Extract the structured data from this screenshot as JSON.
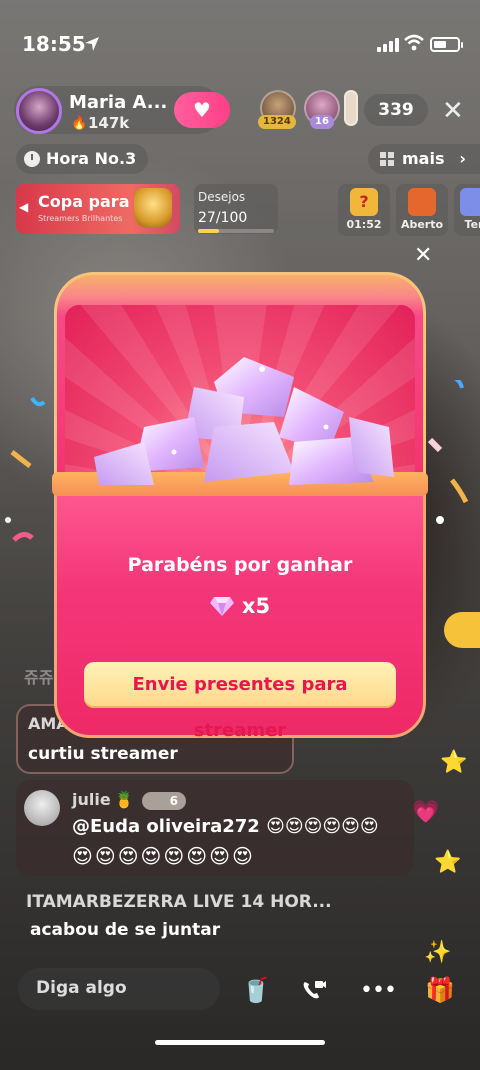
{
  "status_bar": {
    "time": "18:55"
  },
  "header": {
    "streamer_name": "Maria A...",
    "followers": "147k",
    "viewers": [
      {
        "badge": "1324"
      },
      {
        "badge": "16"
      }
    ],
    "viewer_count": "339"
  },
  "row2": {
    "hour_label": "Hora No.3",
    "more_label": "mais"
  },
  "row3": {
    "cup_title": "Copa para",
    "cup_subtitle": "Streamers Brilhantes",
    "wish_title": "Desejos",
    "wish_count": "27/100",
    "wish_progress": 0.27,
    "mini": [
      {
        "label": "01:52"
      },
      {
        "label": "Aberto"
      },
      {
        "label": "Ter"
      }
    ]
  },
  "modal": {
    "title": "Parabéns por ganhar",
    "reward_amount": "x5",
    "button_label": "Envie presentes para streamer"
  },
  "chat": [
    {
      "name": "AMA",
      "text": "curtiu streamer"
    },
    {
      "name": "julie",
      "level": "6",
      "text": "@Euda oliveira272 😍😍😍😍😍😍",
      "text2": "😍😍😍😍😍😍😍😍"
    },
    {
      "name": "ITAMARBEZERRA LIVE 14 HOR...",
      "text": "acabou de se juntar"
    }
  ],
  "chat_faded": "쥬쥬",
  "bottom": {
    "input_placeholder": "Diga algo"
  },
  "colors": {
    "accent_pink": "#f4306e",
    "button_text": "#e4184e",
    "button_bg": "#ffe3a0"
  }
}
